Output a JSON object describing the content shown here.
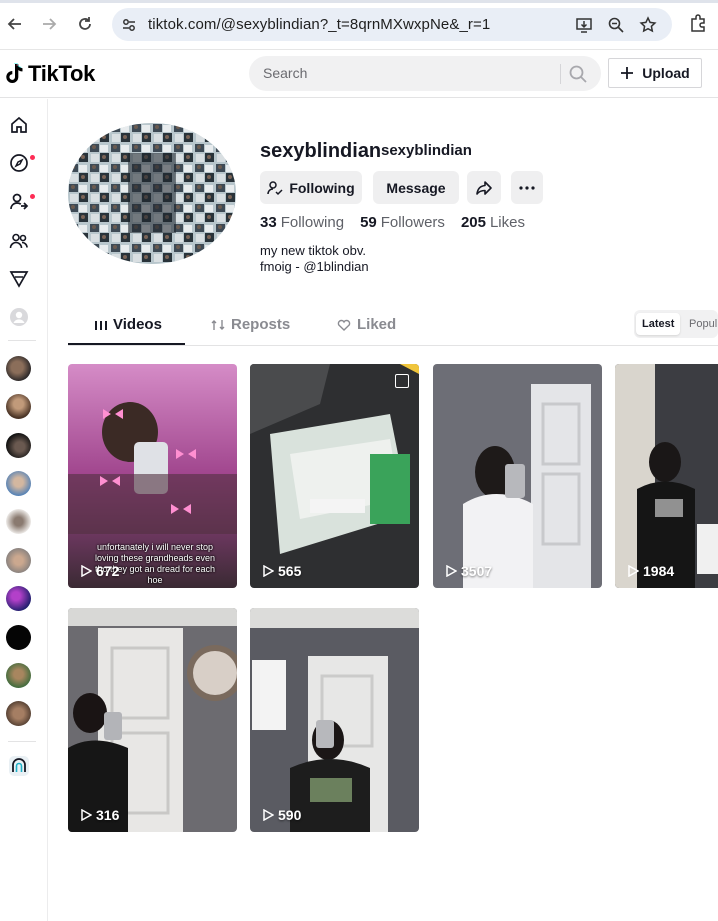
{
  "browser": {
    "url": "tiktok.com/@sexyblindian?_t=8qrnMXwxpNe&_r=1"
  },
  "header": {
    "logo_text": "TikTok",
    "search_placeholder": "Search",
    "upload_label": "Upload"
  },
  "profile": {
    "username": "sexyblindian",
    "nickname": "sexyblindian",
    "following_button": "Following",
    "message_button": "Message",
    "stats": {
      "following_count": "33",
      "following_label": "Following",
      "followers_count": "59",
      "followers_label": "Followers",
      "likes_count": "205",
      "likes_label": "Likes"
    },
    "bio_line1": "my new tiktok obv.",
    "bio_line2": "fmoig - @1blindian"
  },
  "tabs": {
    "videos": "Videos",
    "reposts": "Reposts",
    "liked": "Liked",
    "sort_latest": "Latest",
    "sort_popular": "Popul"
  },
  "videos": [
    {
      "views": "672",
      "caption": "unfortanately i will never stop loving these grandheads even tho they got an dread for each hoe",
      "colors": [
        "#b0418f",
        "#e7a3d2"
      ]
    },
    {
      "views": "565",
      "colors": [
        "#3a3a3a",
        "#cfd8d2"
      ]
    },
    {
      "views": "3507",
      "colors": [
        "#6f7079",
        "#b9bcc3"
      ]
    },
    {
      "views": "1984",
      "colors": [
        "#4b4b4f",
        "#c7c3bc"
      ]
    },
    {
      "views": "316",
      "colors": [
        "#5b5a5e",
        "#c8c8c6"
      ]
    },
    {
      "views": "590",
      "colors": [
        "#595a60",
        "#cacbce"
      ]
    }
  ],
  "colors": {
    "accent": "#fe2c55",
    "text": "#161823",
    "muted": "#5f6168"
  }
}
